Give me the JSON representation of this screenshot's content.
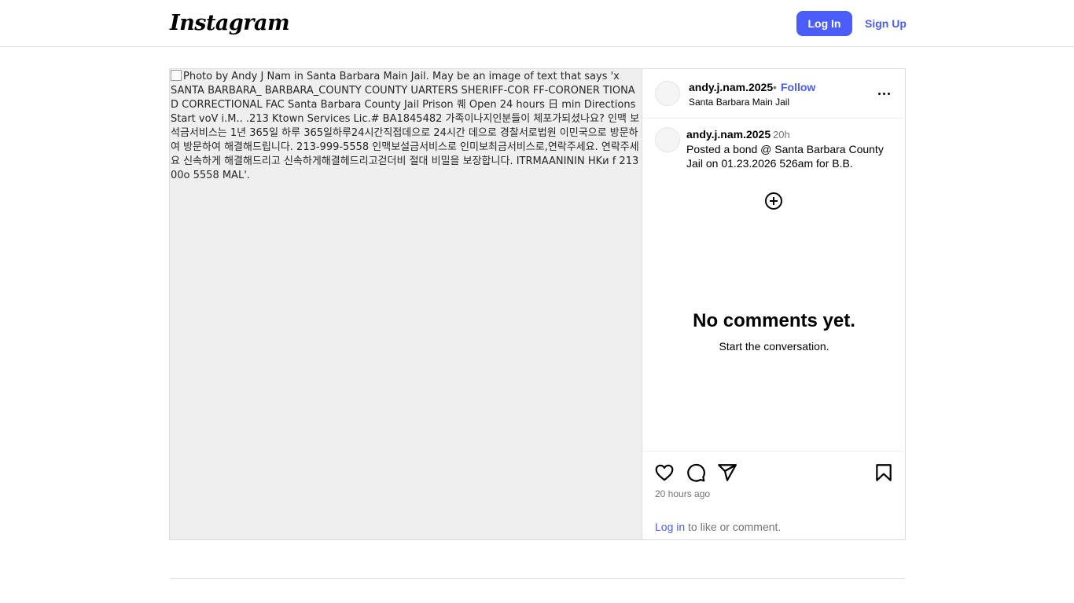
{
  "nav": {
    "logo": "Instagram",
    "login_label": "Log In",
    "signup_label": "Sign Up"
  },
  "post": {
    "image_alt": "Photo by Andy J Nam in Santa Barbara Main Jail. May be an image of text that says 'x SANTA BARBARA_ BARBARA_COUNTY COUNTY UARTERS SHERIFF-COR FF-CORONER TIONA D CORRECTIONAL FAC Santa Barbara County Jail Prison 퀘 Open 24 hours 日 min Directions Start voV i.M.. .213 Ktown Services Lic.# BA1845482 가족이나지인분들이 체포가되셨나요? 인맥 보석금서비스는 1년 365일 하루 365일하루24시간직접데으로 24시간 데으로 경찰서로법원 이민국으로 방문하여 방문하여 해결해드립니다. 213-999-5558 인맥보설금서비스로 인미보최금서비스로,연락주세요. 연락주세요 신속하게 해결해드리고 신속하게해결헤드리고걷더비 절대 비밀을 보장합니다. ITRMAANININ HKи f 213 00o 5558 MAL'.",
    "header": {
      "username": "andy.j.nam.2025",
      "separator": "•",
      "follow_label": "Follow",
      "location": "Santa Barbara Main Jail",
      "more_icon": "more-horizontal-icon"
    },
    "caption": {
      "username": "andy.j.nam.2025",
      "time": "20h",
      "text": "Posted a bond @ Santa Barbara County Jail on 01.23.2026 526am for B.B."
    },
    "load_more_icon": "plus-circle-icon",
    "empty": {
      "title": "No comments yet.",
      "subtitle": "Start the conversation."
    },
    "actions": {
      "icons": [
        "heart-icon",
        "comment-icon",
        "share-icon",
        "bookmark-icon"
      ],
      "timestamp": "20 hours ago",
      "login_link": "Log in",
      "login_suffix": " to like or comment."
    }
  },
  "colors": {
    "accent": "#4a5df9",
    "border": "#dbdbdb",
    "muted": "#737373",
    "media_bg": "#efefef"
  }
}
